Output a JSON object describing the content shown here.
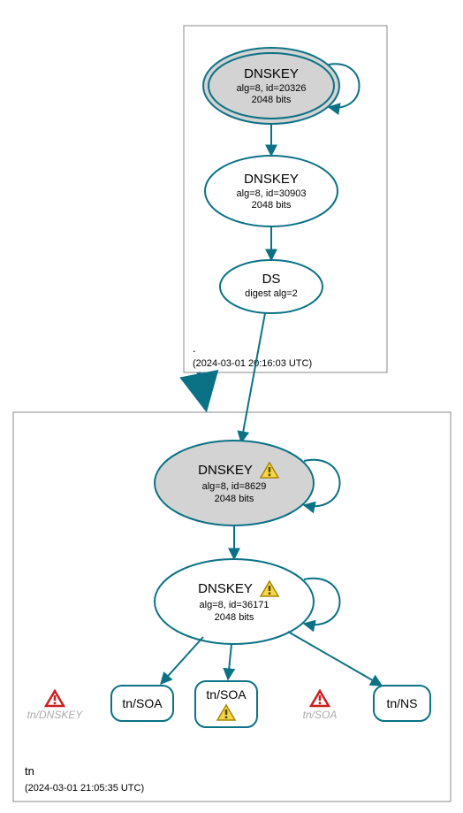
{
  "zones": {
    "root": {
      "label": ".",
      "timestamp": "(2024-03-01 20:16:03 UTC)"
    },
    "tn": {
      "label": "tn",
      "timestamp": "(2024-03-01 21:05:35 UTC)"
    }
  },
  "nodes": {
    "root_ksk": {
      "title": "DNSKEY",
      "line2": "alg=8, id=20326",
      "line3": "2048 bits"
    },
    "root_zsk": {
      "title": "DNSKEY",
      "line2": "alg=8, id=30903",
      "line3": "2048 bits"
    },
    "root_ds": {
      "title": "DS",
      "line2": "digest alg=2"
    },
    "tn_ksk": {
      "title": "DNSKEY",
      "line2": "alg=8, id=8629",
      "line3": "2048 bits"
    },
    "tn_zsk": {
      "title": "DNSKEY",
      "line2": "alg=8, id=36171",
      "line3": "2048 bits"
    },
    "tn_soa1": {
      "title": "tn/SOA"
    },
    "tn_soa2": {
      "title": "tn/SOA"
    },
    "tn_ns": {
      "title": "tn/NS"
    }
  },
  "warnings": {
    "tn_dnskey": "tn/DNSKEY",
    "tn_soa": "tn/SOA"
  },
  "icons": {
    "warn_yellow": "⚠",
    "warn_red": "⚠"
  }
}
